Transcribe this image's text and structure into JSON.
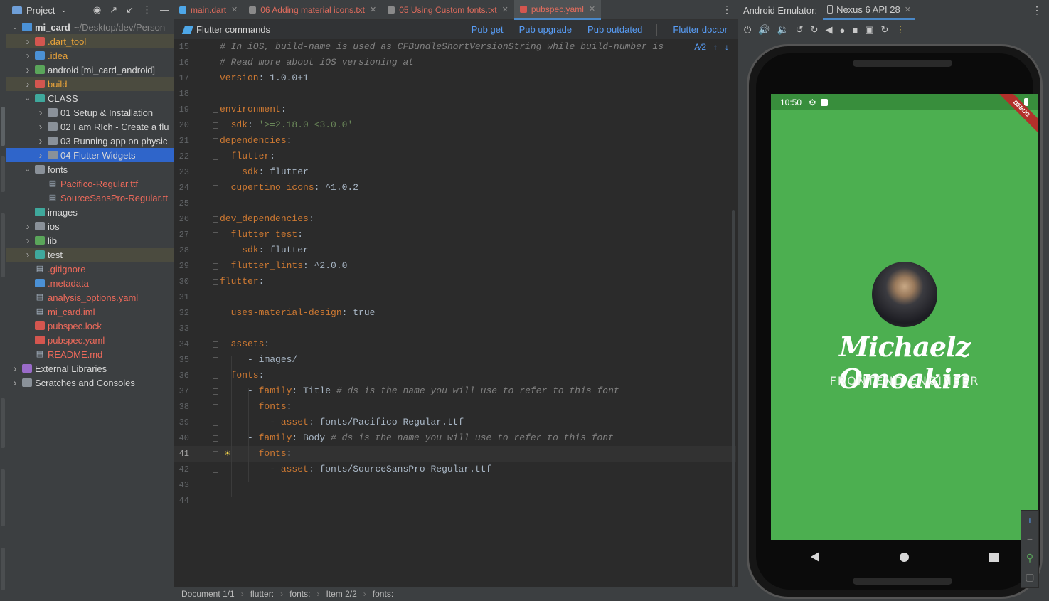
{
  "project_panel": {
    "title": "Project",
    "items": [
      {
        "label": "mi_card",
        "extra": "~/Desktop/dev/Person",
        "depth": 0,
        "arrow": "open",
        "icon": "flutter",
        "color": "white"
      },
      {
        "label": ".dart_tool",
        "depth": 1,
        "arrow": "closed",
        "icon": "red",
        "color": "orange",
        "hl": true
      },
      {
        "label": ".idea",
        "depth": 1,
        "arrow": "closed",
        "icon": "blue",
        "color": "orange"
      },
      {
        "label": "android [mi_card_android]",
        "depth": 1,
        "arrow": "closed",
        "icon": "green",
        "color": "white"
      },
      {
        "label": "build",
        "depth": 1,
        "arrow": "closed",
        "icon": "red",
        "color": "orange",
        "hl": true
      },
      {
        "label": "CLASS",
        "depth": 1,
        "arrow": "open",
        "icon": "teal",
        "color": "white"
      },
      {
        "label": "01 Setup & Installation",
        "depth": 2,
        "arrow": "closed",
        "icon": "folder",
        "color": "white"
      },
      {
        "label": "02 I am RIch - Create a flu",
        "depth": 2,
        "arrow": "closed",
        "icon": "folder",
        "color": "white"
      },
      {
        "label": "03 Running app on physic",
        "depth": 2,
        "arrow": "closed",
        "icon": "folder",
        "color": "white"
      },
      {
        "label": "04 Flutter Widgets",
        "depth": 2,
        "arrow": "closed",
        "icon": "folder",
        "color": "white",
        "sel": true
      },
      {
        "label": "fonts",
        "depth": 1,
        "arrow": "open",
        "icon": "folder",
        "color": "white"
      },
      {
        "label": "Pacifico-Regular.ttf",
        "depth": 2,
        "arrow": "",
        "icon": "doc",
        "color": "red"
      },
      {
        "label": "SourceSansPro-Regular.tt",
        "depth": 2,
        "arrow": "",
        "icon": "doc",
        "color": "red"
      },
      {
        "label": "images",
        "depth": 1,
        "arrow": "",
        "icon": "teal",
        "color": "white"
      },
      {
        "label": "ios",
        "depth": 1,
        "arrow": "closed",
        "icon": "folder",
        "color": "white"
      },
      {
        "label": "lib",
        "depth": 1,
        "arrow": "closed",
        "icon": "green",
        "color": "white"
      },
      {
        "label": "test",
        "depth": 1,
        "arrow": "closed",
        "icon": "teal",
        "color": "white",
        "hl": true
      },
      {
        "label": ".gitignore",
        "depth": 1,
        "arrow": "",
        "icon": "doc",
        "color": "red"
      },
      {
        "label": ".metadata",
        "depth": 1,
        "arrow": "",
        "icon": "flutter",
        "color": "red"
      },
      {
        "label": "analysis_options.yaml",
        "depth": 1,
        "arrow": "",
        "icon": "doc",
        "color": "red"
      },
      {
        "label": "mi_card.iml",
        "depth": 1,
        "arrow": "",
        "icon": "doc",
        "color": "red"
      },
      {
        "label": "pubspec.lock",
        "depth": 1,
        "arrow": "",
        "icon": "red",
        "color": "red"
      },
      {
        "label": "pubspec.yaml",
        "depth": 1,
        "arrow": "",
        "icon": "red",
        "color": "red"
      },
      {
        "label": "README.md",
        "depth": 1,
        "arrow": "",
        "icon": "doc",
        "color": "red"
      },
      {
        "label": "External Libraries",
        "depth": 0,
        "arrow": "closed",
        "icon": "lib",
        "color": "white"
      },
      {
        "label": "Scratches and Consoles",
        "depth": 0,
        "arrow": "closed",
        "icon": "folder",
        "color": "white"
      }
    ]
  },
  "tabs": [
    {
      "label": "main.dart",
      "active": false
    },
    {
      "label": "06 Adding material icons.txt",
      "active": false
    },
    {
      "label": "05 Using Custom fonts.txt",
      "active": false
    },
    {
      "label": "pubspec.yaml",
      "active": true
    }
  ],
  "flutter_bar": {
    "title": "Flutter commands",
    "actions": [
      "Pub get",
      "Pub upgrade",
      "Pub outdated",
      "Flutter doctor"
    ]
  },
  "editor": {
    "inspection": "2",
    "current_line": 41,
    "lines": [
      {
        "n": 15,
        "segs": [
          [
            "# In iOS, build-name is used as CFBundleShortVersionString while build-number is",
            "com"
          ]
        ]
      },
      {
        "n": 16,
        "segs": [
          [
            "# Read more about iOS versioning at",
            "com"
          ]
        ]
      },
      {
        "n": 17,
        "segs": [
          [
            "version",
            "key"
          ],
          [
            ": 1.0.0+1",
            "val"
          ]
        ]
      },
      {
        "n": 18,
        "segs": []
      },
      {
        "n": 19,
        "segs": [
          [
            "environment",
            "key"
          ],
          [
            ":",
            "val"
          ]
        ],
        "fold": true
      },
      {
        "n": 20,
        "segs": [
          [
            "  sdk",
            "key"
          ],
          [
            ": ",
            "val"
          ],
          [
            "'>=2.18.0 <3.0.0'",
            "str"
          ]
        ],
        "fold": true
      },
      {
        "n": 21,
        "segs": [
          [
            "dependencies",
            "key"
          ],
          [
            ":",
            "val"
          ]
        ],
        "fold": true
      },
      {
        "n": 22,
        "segs": [
          [
            "  flutter",
            "key"
          ],
          [
            ":",
            "val"
          ]
        ],
        "fold": true
      },
      {
        "n": 23,
        "segs": [
          [
            "    sdk",
            "key"
          ],
          [
            ": flutter",
            "val"
          ]
        ]
      },
      {
        "n": 24,
        "segs": [
          [
            "  cupertino_icons",
            "key"
          ],
          [
            ": ^1.0.2",
            "val"
          ]
        ],
        "fold": true
      },
      {
        "n": 25,
        "segs": []
      },
      {
        "n": 26,
        "segs": [
          [
            "dev_dependencies",
            "key"
          ],
          [
            ":",
            "val"
          ]
        ],
        "fold": true
      },
      {
        "n": 27,
        "segs": [
          [
            "  flutter_test",
            "key"
          ],
          [
            ":",
            "val"
          ]
        ],
        "fold": true
      },
      {
        "n": 28,
        "segs": [
          [
            "    sdk",
            "key"
          ],
          [
            ": flutter",
            "val"
          ]
        ]
      },
      {
        "n": 29,
        "segs": [
          [
            "  flutter_lints",
            "key"
          ],
          [
            ": ^2.0.0",
            "val"
          ]
        ],
        "fold": true
      },
      {
        "n": 30,
        "segs": [
          [
            "flutter",
            "key"
          ],
          [
            ":",
            "val"
          ]
        ],
        "fold": true
      },
      {
        "n": 31,
        "segs": []
      },
      {
        "n": 32,
        "segs": [
          [
            "  uses-material-design",
            "key"
          ],
          [
            ": true",
            "val"
          ]
        ]
      },
      {
        "n": 33,
        "segs": []
      },
      {
        "n": 34,
        "segs": [
          [
            "  assets",
            "key"
          ],
          [
            ":",
            "val"
          ]
        ],
        "fold": true
      },
      {
        "n": 35,
        "segs": [
          [
            "     - images/",
            "val"
          ]
        ],
        "fold": true
      },
      {
        "n": 36,
        "segs": [
          [
            "  fonts",
            "key"
          ],
          [
            ":",
            "val"
          ]
        ],
        "fold": true
      },
      {
        "n": 37,
        "segs": [
          [
            "     - ",
            "val"
          ],
          [
            "family",
            "key"
          ],
          [
            ": Title ",
            "val"
          ],
          [
            "# ds is the name you will use to refer to this font",
            "com"
          ]
        ],
        "fold": true
      },
      {
        "n": 38,
        "segs": [
          [
            "       fonts",
            "key"
          ],
          [
            ":",
            "val"
          ]
        ],
        "fold": true
      },
      {
        "n": 39,
        "segs": [
          [
            "         - ",
            "val"
          ],
          [
            "asset",
            "key"
          ],
          [
            ": fonts/Pacifico-Regular.ttf",
            "val"
          ]
        ],
        "fold": true
      },
      {
        "n": 40,
        "segs": [
          [
            "     - ",
            "val"
          ],
          [
            "family",
            "key"
          ],
          [
            ": Body ",
            "val"
          ],
          [
            "# ds is the name you will use to refer to this font",
            "com"
          ]
        ],
        "fold": true
      },
      {
        "n": 41,
        "segs": [
          [
            "       fonts",
            "key"
          ],
          [
            ":",
            "val"
          ]
        ],
        "fold": true
      },
      {
        "n": 42,
        "segs": [
          [
            "         - ",
            "val"
          ],
          [
            "asset",
            "key"
          ],
          [
            ": fonts/SourceSansPro-Regular.ttf",
            "val"
          ]
        ],
        "fold": true
      },
      {
        "n": 43,
        "segs": []
      },
      {
        "n": 44,
        "segs": []
      }
    ]
  },
  "breadcrumbs": [
    "Document 1/1",
    "flutter:",
    "fonts:",
    "Item 2/2",
    "fonts:"
  ],
  "emulator": {
    "label": "Android Emulator:",
    "device": "Nexus 6 API 28",
    "time": "10:50",
    "debug_banner": "DEBUG",
    "app_name": "Michaelz Omoakin",
    "app_role": "FRONTEND ENGINEER",
    "screen_color": "#4caf50"
  },
  "colors": {
    "accent": "#4a88c7",
    "selection": "#2f65ca",
    "link": "#589df6"
  }
}
